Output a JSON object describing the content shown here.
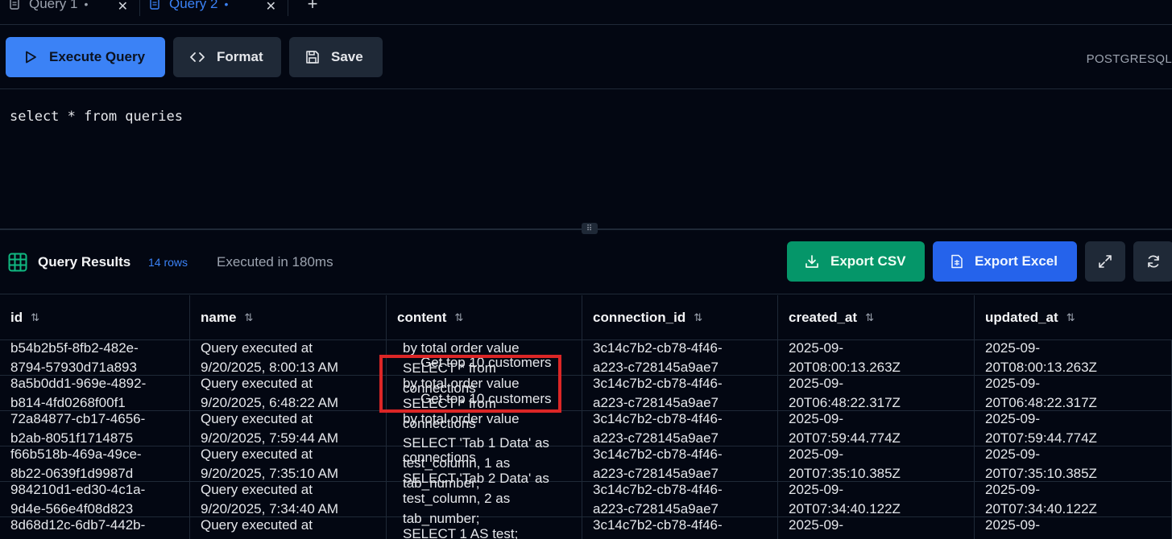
{
  "tabs": [
    {
      "label": "Query 1",
      "dot": "•",
      "close": "✕",
      "active": false
    },
    {
      "label": "Query 2",
      "dot": "•",
      "close": "✕",
      "active": true
    }
  ],
  "add_tab": "+",
  "toolbar": {
    "execute_label": "Execute Query",
    "format_label": "Format",
    "save_label": "Save",
    "dialect": "POSTGRESQL"
  },
  "editor": {
    "sql": "select * from queries"
  },
  "results": {
    "title": "Query Results",
    "row_count": "14 rows",
    "exec_time": "Executed in 180ms",
    "export_csv_label": "Export CSV",
    "export_excel_label": "Export Excel"
  },
  "table": {
    "sort_glyph": "⇅",
    "columns": [
      "id",
      "name",
      "content",
      "connection_id",
      "created_at",
      "updated_at"
    ],
    "rows": [
      {
        "id": [
          "b54b2b5f-8fb2-482e-",
          "8794-57930d71a893"
        ],
        "name": [
          "Query executed at",
          "9/20/2025, 8:00:13 AM"
        ],
        "connection_id": [
          "3c14c7b2-cb78-4f46-",
          "a223-c728145a9ae7"
        ],
        "created_at": [
          "2025-09-",
          "20T08:00:13.263Z"
        ],
        "updated_at": [
          "2025-09-",
          "20T08:00:13.263Z"
        ]
      },
      {
        "id": [
          "8a5b0dd1-969e-4892-",
          "b814-4fd0268f00f1"
        ],
        "name": [
          "Query executed at",
          "9/20/2025, 6:48:22 AM"
        ],
        "connection_id": [
          "3c14c7b2-cb78-4f46-",
          "a223-c728145a9ae7"
        ],
        "created_at": [
          "2025-09-",
          "20T06:48:22.317Z"
        ],
        "updated_at": [
          "2025-09-",
          "20T06:48:22.317Z"
        ]
      },
      {
        "id": [
          "72a84877-cb17-4656-",
          "b2ab-8051f1714875"
        ],
        "name": [
          "Query executed at",
          "9/20/2025, 7:59:44 AM"
        ],
        "connection_id": [
          "3c14c7b2-cb78-4f46-",
          "a223-c728145a9ae7"
        ],
        "created_at": [
          "2025-09-",
          "20T07:59:44.774Z"
        ],
        "updated_at": [
          "2025-09-",
          "20T07:59:44.774Z"
        ]
      },
      {
        "id": [
          "f66b518b-469a-49ce-",
          "8b22-0639f1d9987d"
        ],
        "name": [
          "Query executed at",
          "9/20/2025, 7:35:10 AM"
        ],
        "connection_id": [
          "3c14c7b2-cb78-4f46-",
          "a223-c728145a9ae7"
        ],
        "created_at": [
          "2025-09-",
          "20T07:35:10.385Z"
        ],
        "updated_at": [
          "2025-09-",
          "20T07:35:10.385Z"
        ]
      },
      {
        "id": [
          "984210d1-ed30-4c1a-",
          "9d4e-566e4f08d823"
        ],
        "name": [
          "Query executed at",
          "9/20/2025, 7:34:40 AM"
        ],
        "connection_id": [
          "3c14c7b2-cb78-4f46-",
          "a223-c728145a9ae7"
        ],
        "created_at": [
          "2025-09-",
          "20T07:34:40.122Z"
        ],
        "updated_at": [
          "2025-09-",
          "20T07:34:40.122Z"
        ]
      },
      {
        "id": [
          "8d68d12c-6db7-442b-",
          ""
        ],
        "name": [
          "Query executed at",
          ""
        ],
        "connection_id": [
          "3c14c7b2-cb78-4f46-",
          ""
        ],
        "created_at": [
          "2025-09-",
          ""
        ],
        "updated_at": [
          "2025-09-",
          ""
        ]
      }
    ],
    "content_lines": [
      "by total order value",
      "SELECT * from",
      "by total order value",
      "connections",
      "SELECT * from",
      "by total order value",
      "connections",
      "SELECT 'Tab 1 Data' as",
      "test_column, 1 as",
      "connections",
      "SELECT 'Tab 2 Data' as",
      "tab_number;",
      "test_column, 2 as",
      "tab_number;",
      "SELECT 1 AS test;"
    ],
    "overlay_lines": [
      "Get top 10 customers",
      "Get top 10 customers"
    ]
  },
  "colors": {
    "background": "#030712",
    "accent_blue": "#3b82f6",
    "export_green": "#059669",
    "highlight_red": "#dc2626"
  }
}
